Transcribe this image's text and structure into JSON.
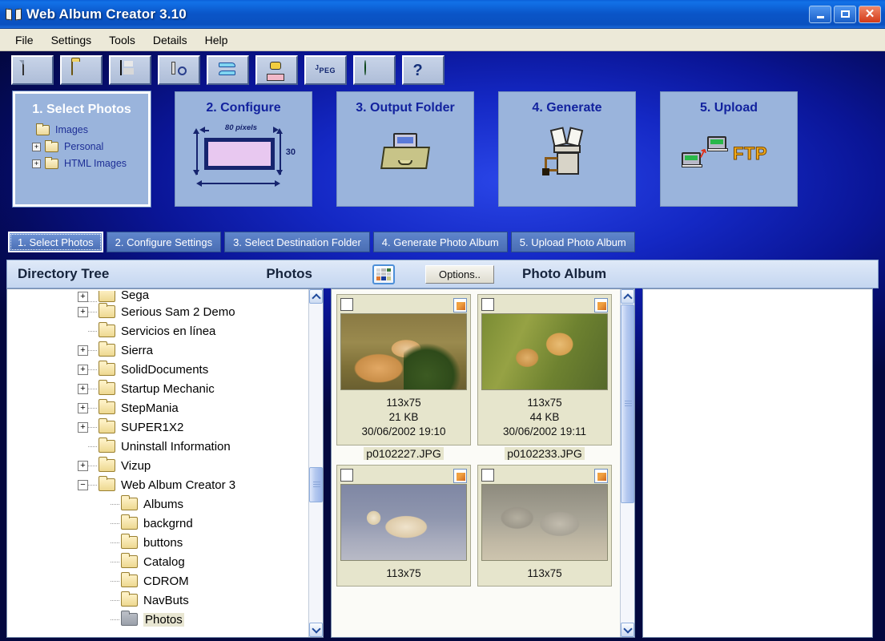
{
  "window": {
    "title": "Web Album Creator 3.10",
    "icon": "book-icon",
    "minimize_label": "Minimize",
    "maximize_label": "Maximize",
    "close_label": "Close"
  },
  "menu": {
    "items": [
      {
        "label": "File"
      },
      {
        "label": "Settings"
      },
      {
        "label": "Tools"
      },
      {
        "label": "Details"
      },
      {
        "label": "Help"
      }
    ]
  },
  "toolbar": {
    "buttons": [
      {
        "icon": "new-document-icon",
        "label": "New"
      },
      {
        "icon": "open-folder-icon",
        "label": "Open"
      },
      {
        "icon": "save-diskette-icon",
        "label": "Save"
      },
      {
        "icon": "tool-wrench-icon",
        "label": "Tools"
      },
      {
        "icon": "convert-arrows-icon",
        "label": "Convert"
      },
      {
        "icon": "fax-machine-icon",
        "label": "Fax"
      },
      {
        "icon": "jpeg-icon",
        "label": "JPEG",
        "text_top": "J",
        "text_mid": "P",
        "text_bot": "EG"
      },
      {
        "icon": "globe-icon",
        "label": "Web"
      },
      {
        "icon": "help-question-icon",
        "label": "Help"
      }
    ]
  },
  "steps": [
    {
      "title": "1. Select Photos",
      "active": true,
      "tree": [
        {
          "label": "Images",
          "has_plus": false,
          "indent": 0
        },
        {
          "label": "Personal",
          "has_plus": true,
          "plus": "+",
          "indent": 1
        },
        {
          "label": "HTML Images",
          "has_plus": true,
          "plus": "+",
          "indent": 1
        }
      ]
    },
    {
      "title": "2. Configure",
      "active": false,
      "diagram": {
        "width_label": "80 pixels",
        "height_label": "30"
      }
    },
    {
      "title": "3. Output Folder",
      "active": false,
      "icon": "file-drawer-icon"
    },
    {
      "title": "4. Generate",
      "active": false,
      "icon": "generator-icon"
    },
    {
      "title": "5. Upload",
      "active": false,
      "icon": "ftp-upload-icon",
      "ftp_label": "FTP"
    }
  ],
  "wizard_tabs": [
    {
      "label": "1. Select Photos",
      "active": true
    },
    {
      "label": "2. Configure Settings",
      "active": false
    },
    {
      "label": "3. Select Destination Folder",
      "active": false
    },
    {
      "label": "4. Generate Photo Album",
      "active": false
    },
    {
      "label": "5. Upload Photo Album",
      "active": false
    }
  ],
  "content_header": {
    "directory_tree_title": "Directory Tree",
    "photos_title": "Photos",
    "grid_view_icon": "thumbnail-grid-icon",
    "options_button": "Options..",
    "photo_album_title": "Photo Album"
  },
  "directory_tree": {
    "rows": [
      {
        "label": "Sega",
        "indent": 1,
        "plus": "+",
        "selected": false,
        "clipped": true
      },
      {
        "label": "Serious Sam 2 Demo",
        "indent": 1,
        "plus": "+",
        "selected": false
      },
      {
        "label": "Servicios en línea",
        "indent": 1,
        "plus": "",
        "selected": false
      },
      {
        "label": "Sierra",
        "indent": 1,
        "plus": "+",
        "selected": false
      },
      {
        "label": "SolidDocuments",
        "indent": 1,
        "plus": "+",
        "selected": false
      },
      {
        "label": "Startup Mechanic",
        "indent": 1,
        "plus": "+",
        "selected": false
      },
      {
        "label": "StepMania",
        "indent": 1,
        "plus": "+",
        "selected": false
      },
      {
        "label": "SUPER1X2",
        "indent": 1,
        "plus": "+",
        "selected": false
      },
      {
        "label": "Uninstall Information",
        "indent": 1,
        "plus": "",
        "selected": false
      },
      {
        "label": "Vizup",
        "indent": 1,
        "plus": "+",
        "selected": false
      },
      {
        "label": "Web Album Creator 3",
        "indent": 1,
        "plus": "−",
        "selected": false
      },
      {
        "label": "Albums",
        "indent": 2,
        "plus": "",
        "selected": false
      },
      {
        "label": "backgrnd",
        "indent": 2,
        "plus": "",
        "selected": false
      },
      {
        "label": "buttons",
        "indent": 2,
        "plus": "",
        "selected": false
      },
      {
        "label": "Catalog",
        "indent": 2,
        "plus": "",
        "selected": false
      },
      {
        "label": "CDROM",
        "indent": 2,
        "plus": "",
        "selected": false
      },
      {
        "label": "NavButs",
        "indent": 2,
        "plus": "",
        "selected": false
      },
      {
        "label": "Photos",
        "indent": 2,
        "plus": "",
        "selected": true,
        "folder_color": "grey"
      }
    ]
  },
  "photos": [
    {
      "filename": "p0102227.JPG",
      "dimensions": "113x75",
      "size": "21 KB",
      "date": "30/06/2002 19:10",
      "checked": false,
      "thumb_class": "img-cheetah",
      "thumb_alt": "cheetah-thumbnail"
    },
    {
      "filename": "p0102233.JPG",
      "dimensions": "113x75",
      "size": "44 KB",
      "date": "30/06/2002 19:11",
      "checked": false,
      "thumb_class": "img-cub",
      "thumb_alt": "lion-cub-thumbnail"
    },
    {
      "filename": "",
      "dimensions": "113x75",
      "size": "",
      "date": "",
      "checked": false,
      "thumb_class": "img-bear",
      "thumb_alt": "polar-bear-thumbnail"
    },
    {
      "filename": "",
      "dimensions": "113x75",
      "size": "",
      "date": "",
      "checked": false,
      "thumb_class": "img-rhino",
      "thumb_alt": "rhinoceros-thumbnail"
    }
  ],
  "photo_album": {
    "items": []
  },
  "colors": {
    "titlebar_blue": "#0a55c8",
    "stage_blue": "#1428c4",
    "panel_blue": "#9ab4dc",
    "step_title": "#12229e",
    "active_step_title": "#ffffff",
    "thumb_bg": "#e6e5cc",
    "header_gradient_top": "#dfe9f8",
    "close_red": "#d33a18",
    "ftp_orange": "#f0a818"
  }
}
